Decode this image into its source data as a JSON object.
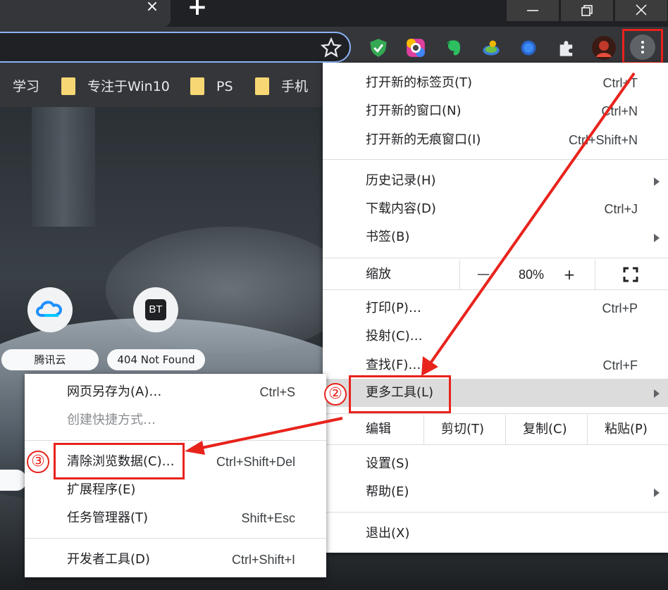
{
  "titlebar": {
    "tab_close": "×",
    "new_tab": "+"
  },
  "bookmarks": [
    {
      "label": "学习"
    },
    {
      "label": "专注于Win10"
    },
    {
      "label": "PS"
    },
    {
      "label": "手机"
    }
  ],
  "shortcuts": [
    {
      "label": "腾讯云",
      "icon": "cloud-icon"
    },
    {
      "label": "404 Not Found",
      "icon_text": "BT"
    }
  ],
  "menu": {
    "items": {
      "new_tab": {
        "label": "打开新的标签页(T)",
        "shortcut": "Ctrl+T"
      },
      "new_window": {
        "label": "打开新的窗口(N)",
        "shortcut": "Ctrl+N"
      },
      "incognito": {
        "label": "打开新的无痕窗口(I)",
        "shortcut": "Ctrl+Shift+N"
      },
      "history": {
        "label": "历史记录(H)"
      },
      "downloads": {
        "label": "下载内容(D)",
        "shortcut": "Ctrl+J"
      },
      "bookmarks": {
        "label": "书签(B)"
      },
      "print": {
        "label": "打印(P)…",
        "shortcut": "Ctrl+P"
      },
      "cast": {
        "label": "投射(C)…"
      },
      "find": {
        "label": "查找(F)…",
        "shortcut": "Ctrl+F"
      },
      "more_tools": {
        "label": "更多工具(L)"
      },
      "settings": {
        "label": "设置(S)"
      },
      "help": {
        "label": "帮助(E)"
      },
      "exit": {
        "label": "退出(X)"
      }
    },
    "zoom": {
      "label": "缩放",
      "minus": "—",
      "value": "80%",
      "plus": "+"
    },
    "edit": {
      "label": "编辑",
      "cut": "剪切(T)",
      "copy": "复制(C)",
      "paste": "粘贴(P)"
    }
  },
  "submenu": {
    "save_as": {
      "label": "网页另存为(A)…",
      "shortcut": "Ctrl+S"
    },
    "create_shortcut": {
      "label": "创建快捷方式…"
    },
    "clear_data": {
      "label": "清除浏览数据(C)…",
      "shortcut": "Ctrl+Shift+Del"
    },
    "extensions": {
      "label": "扩展程序(E)"
    },
    "task_manager": {
      "label": "任务管理器(T)",
      "shortcut": "Shift+Esc"
    },
    "devtools": {
      "label": "开发者工具(D)",
      "shortcut": "Ctrl+Shift+I"
    }
  },
  "annotations": {
    "step2": "②",
    "step3": "③",
    "color": "#e8231c"
  }
}
